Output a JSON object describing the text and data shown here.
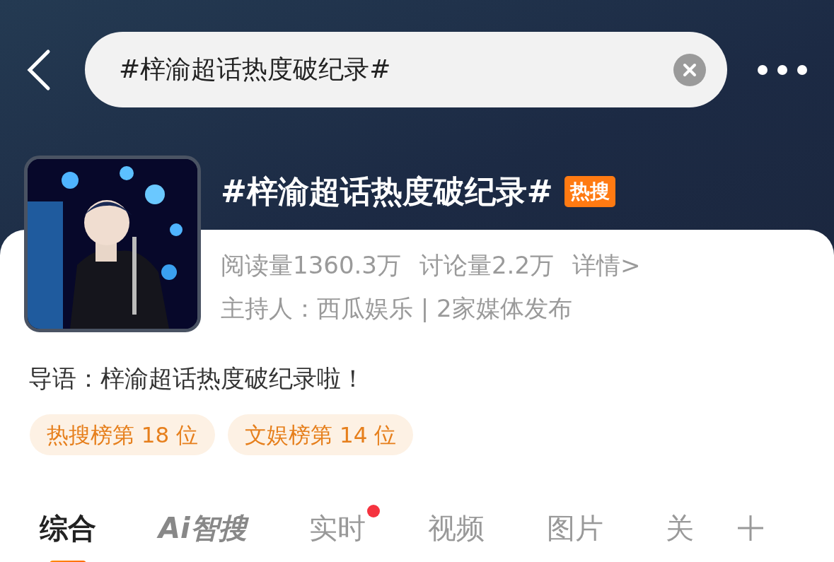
{
  "search": {
    "value": "#梓渝超话热度破纪录#"
  },
  "topic": {
    "title": "#梓渝超话热度破纪录#",
    "badge": "热搜",
    "stats": [
      "阅读量1360.3万",
      "讨论量2.2万"
    ],
    "details_link": "详情>",
    "host": "主持人：西瓜娱乐 | 2家媒体发布"
  },
  "intro": "导语：梓渝超话热度破纪录啦！",
  "rankings": [
    "热搜榜第 18 位",
    "文娱榜第 14 位"
  ],
  "tabs": [
    {
      "label": "综合",
      "selected": true,
      "kind": "text",
      "dot": false
    },
    {
      "label": "Ai智搜",
      "selected": false,
      "kind": "logo",
      "dot": false
    },
    {
      "label": "实时",
      "selected": false,
      "kind": "text",
      "dot": true
    },
    {
      "label": "视频",
      "selected": false,
      "kind": "text",
      "dot": false
    },
    {
      "label": "图片",
      "selected": false,
      "kind": "text",
      "dot": false
    },
    {
      "label": "关",
      "selected": false,
      "kind": "text",
      "dot": false
    }
  ]
}
